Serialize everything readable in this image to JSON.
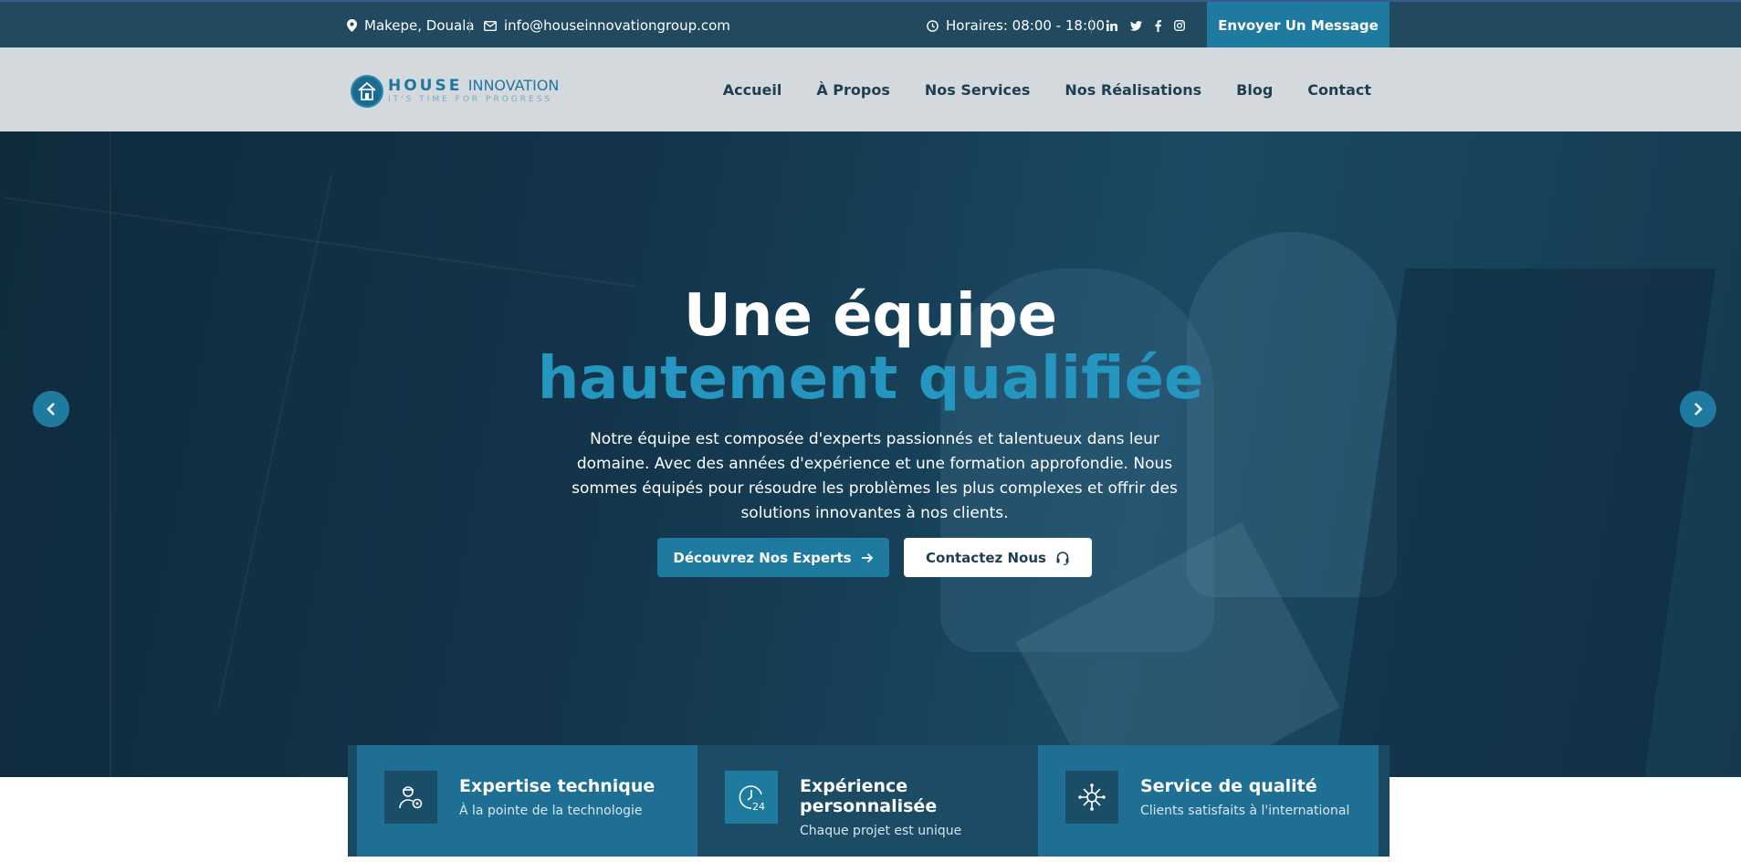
{
  "topbar": {
    "location": "Makepe, Douala",
    "email": "info@houseinnovationgroup.com",
    "hours": "Horaires: 08:00 - 18:00",
    "social_icons": [
      "linkedin-icon",
      "twitter-icon",
      "facebook-icon",
      "instagram-icon"
    ],
    "cta_label": "Envoyer Un Message"
  },
  "logo": {
    "brand_bold": "HOUSE",
    "brand_light": "INNOVATION",
    "tagline": "IT'S TIME FOR PROGRESS"
  },
  "nav": {
    "items": [
      "Accueil",
      "À Propos",
      "Nos Services",
      "Nos Réalisations",
      "Blog",
      "Contact"
    ]
  },
  "hero": {
    "title_line1": "Une équipe",
    "title_line2": "hautement qualifiée",
    "description": "Notre équipe est composée d'experts passionnés et talentueux dans leur domaine. Avec des années d'expérience et une formation approfondie. Nous sommes équipés pour résoudre les problèmes les plus complexes et offrir des solutions innovantes à nos clients.",
    "primary_button": "Découvrez Nos Experts",
    "secondary_button": "Contactez Nous"
  },
  "features": [
    {
      "title": "Expertise technique",
      "subtitle": "À la pointe de la technologie",
      "icon": "engineer-icon"
    },
    {
      "title": "Expérience personnalisée",
      "subtitle": "Chaque projet est unique",
      "icon": "24h-clock-icon"
    },
    {
      "title": "Service de qualité",
      "subtitle": "Clients satisfaits à l'international",
      "icon": "network-icon"
    }
  ],
  "colors": {
    "topbar_bg": "#21495f",
    "accent": "#1f7aa0",
    "accent_light": "#2596c0",
    "nav_bg": "#d4d9de",
    "nav_text": "#1e3f52"
  }
}
